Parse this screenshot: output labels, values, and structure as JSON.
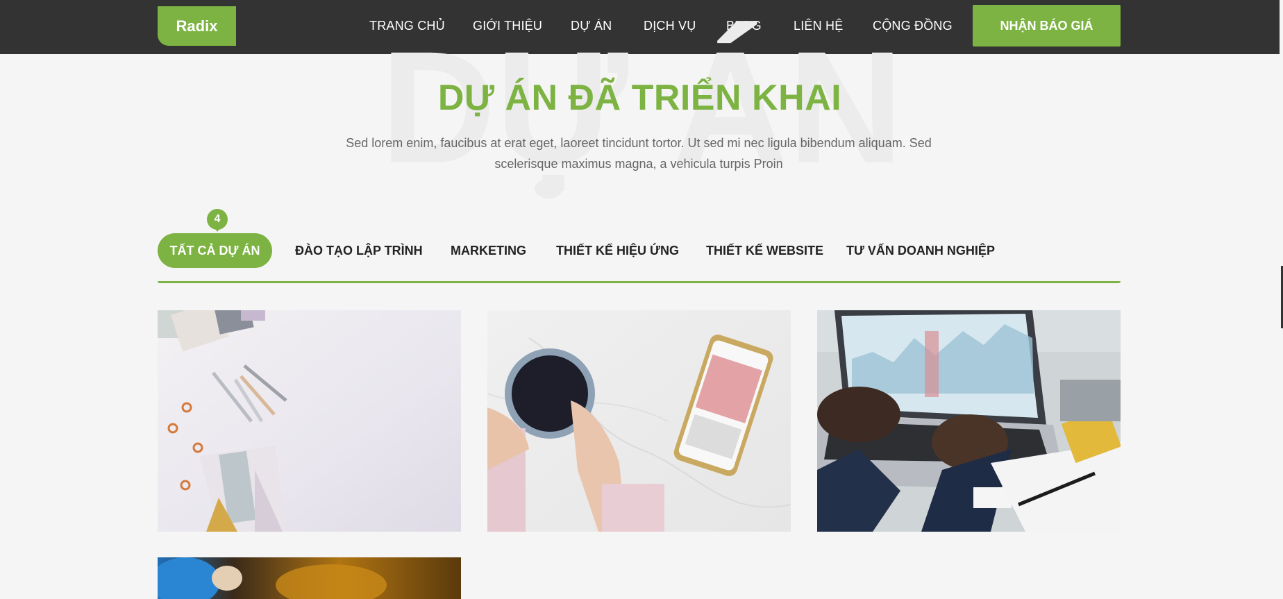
{
  "navbar": {
    "logo": "Radix",
    "menu": [
      {
        "label": "TRANG CHỦ"
      },
      {
        "label": "GIỚI THIỆU"
      },
      {
        "label": "DỰ ÁN"
      },
      {
        "label": "DỊCH VỤ"
      },
      {
        "label": "BLOG"
      },
      {
        "label": "LIÊN HỆ"
      },
      {
        "label": "CỘNG ĐỒNG"
      }
    ],
    "cta_label": "NHẬN BÁO GIÁ"
  },
  "hero": {
    "watermark": "DỰ ÁN",
    "title": "DỰ ÁN ĐÃ TRIỂN KHAI",
    "description": "Sed lorem enim, faucibus at erat eget, laoreet tincidunt tortor. Ut sed mi nec ligula bibendum aliquam. Sed scelerisque maximus magna, a vehicula turpis Proin"
  },
  "filters": {
    "count": "4",
    "tabs": [
      {
        "label": "TẤT CẢ DỰ ÁN"
      },
      {
        "label": "ĐÀO TẠO LẬP TRÌNH"
      },
      {
        "label": "MARKETING"
      },
      {
        "label": "THIẾT KẾ HIỆU ỨNG"
      },
      {
        "label": "THIẾT KẾ WEBSITE"
      },
      {
        "label": "TƯ VẤN DOANH NGHIỆP"
      }
    ]
  },
  "gallery": {
    "items": [
      {
        "image": "desk-stationery-photo"
      },
      {
        "image": "coffee-phone-photo"
      },
      {
        "image": "laptop-analytics-photo"
      },
      {
        "image": "kid-playing-photo"
      }
    ]
  },
  "colors": {
    "accent": "#7cb342",
    "navbar": "#333333",
    "background": "#f5f5f5"
  }
}
